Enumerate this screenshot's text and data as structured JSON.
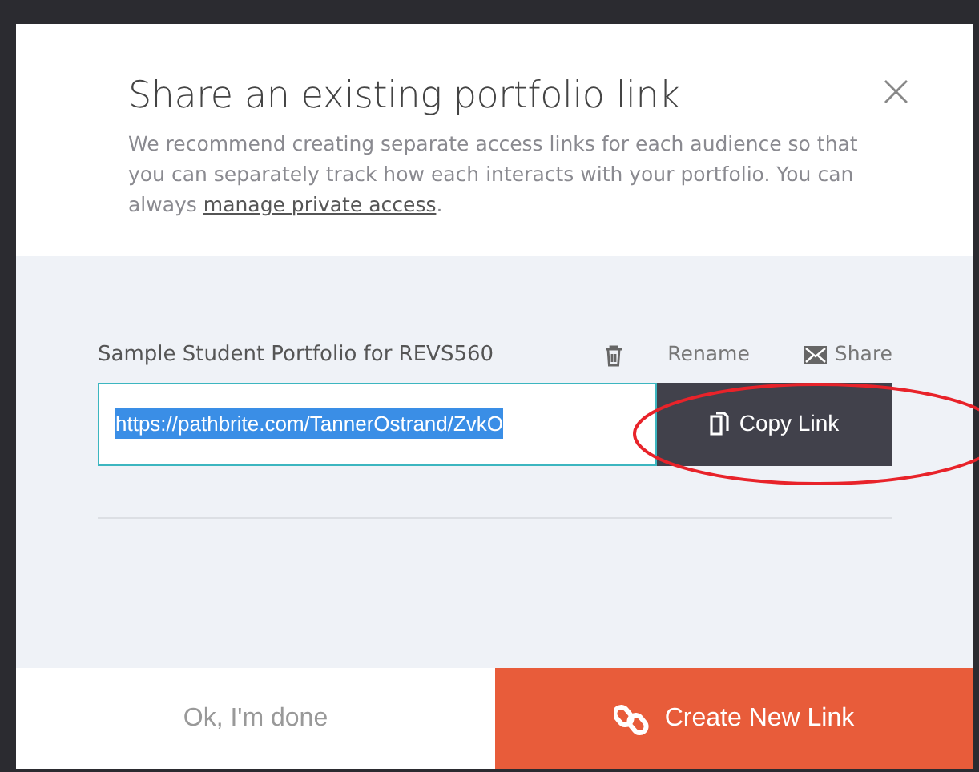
{
  "dialog": {
    "title": "Share an existing portfolio link",
    "description": "We recommend creating separate access links for each audience so that you can separately track how each interacts with your portfolio. You can always ",
    "description_link": "manage private access",
    "description_end": ".",
    "close": "×"
  },
  "portfolio": {
    "name": "Sample Student Portfolio for REVS560",
    "rename": "Rename",
    "share": "Share",
    "url": "https://pathbrite.com/TannerOstrand/ZvkO",
    "url_selected": true,
    "copy": "Copy Link"
  },
  "footer": {
    "done": "Ok, I'm done",
    "create": "Create New Link"
  }
}
